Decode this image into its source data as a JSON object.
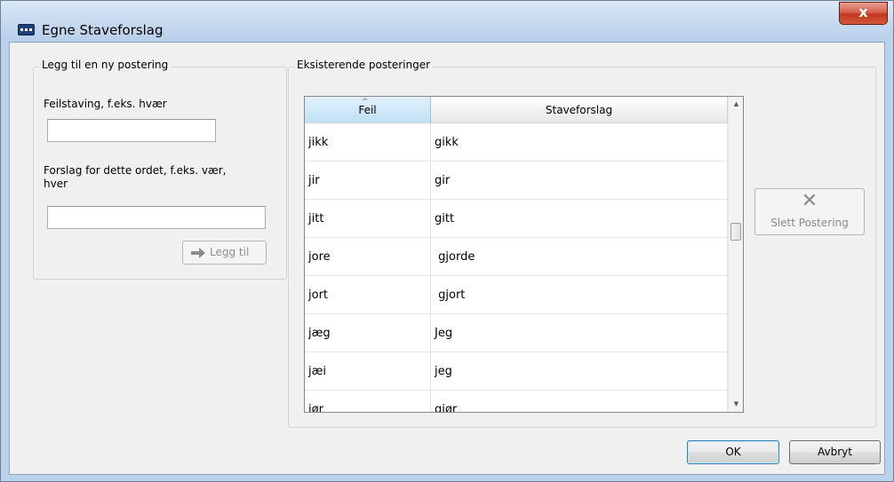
{
  "window": {
    "title": "Egne Staveforslag",
    "close_glyph": "x"
  },
  "add_group": {
    "legend": "Legg til en ny postering",
    "misspelling_label": "Feilstaving, f.eks. hvær",
    "misspelling_value": "",
    "suggestion_label_line1": "Forslag for dette ordet, f.eks. vær,",
    "suggestion_label_line2": "hver",
    "suggestion_value": "",
    "add_button_label": "Legg til",
    "add_icon": "arrow-right-icon"
  },
  "existing_group": {
    "legend": "Eksisterende posteringer",
    "columns": [
      "Feil",
      "Staveforslag"
    ],
    "sort_column": "Feil",
    "sort_glyph": "^",
    "rows": [
      {
        "feil": "jikk",
        "forslag": "gikk"
      },
      {
        "feil": "jir",
        "forslag": "gir"
      },
      {
        "feil": "jitt",
        "forslag": "gitt"
      },
      {
        "feil": "jore",
        "forslag": " gjorde"
      },
      {
        "feil": "jort",
        "forslag": " gjort"
      },
      {
        "feil": "jæg",
        "forslag": "Jeg"
      },
      {
        "feil": "jæi",
        "forslag": "jeg"
      },
      {
        "feil": "jør",
        "forslag": "gjør"
      }
    ]
  },
  "delete_button": {
    "label": "Slett Postering",
    "icon": "x-icon",
    "glyph": "✕"
  },
  "buttons": {
    "ok": "OK",
    "cancel": "Avbryt"
  },
  "colors": {
    "title_bar": "#c6d9ef",
    "close_button": "#c4371f",
    "grid_header_selected": "#d0e9f8",
    "dialog_bg": "#f0f0f0"
  }
}
